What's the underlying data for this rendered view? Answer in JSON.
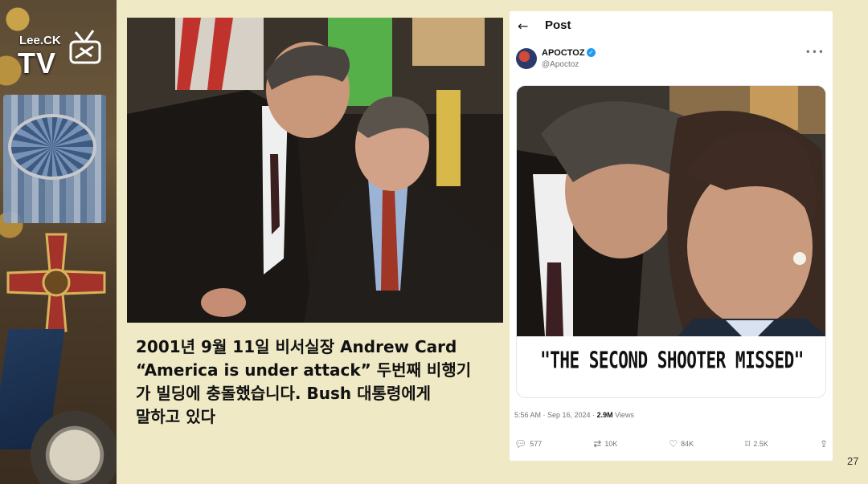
{
  "logo": {
    "small_text": "Lee.CK",
    "big_text": "TV"
  },
  "slide": {
    "caption_lines": [
      "2001년 9월 11일 비서실장  Andrew Card",
      "“America is under attack” 두번째 비행기",
      "가 빌딩에 충돌했습니다.  Bush 대통령에게",
      "말하고 있다"
    ],
    "page_number": "27",
    "background": "#efe9c6"
  },
  "tweet": {
    "header_title": "Post",
    "display_name": "APOCTOZ",
    "handle": "@Apoctoz",
    "image_text": "\"THE SECOND SHOOTER MISSED\"",
    "timestamp": "5:56 AM · Sep 16, 2024 · ",
    "views_count": "2.9M",
    "views_label": " Views",
    "actions": {
      "replies": "577",
      "reposts": "10K",
      "likes": "84K",
      "bookmarks": "2.5K"
    },
    "icons": [
      "back-arrow-icon",
      "verified-badge-icon",
      "more-icon",
      "reply-icon",
      "repost-icon",
      "like-icon",
      "bookmark-icon",
      "share-icon"
    ],
    "verified_color": "#1d9bf0"
  }
}
